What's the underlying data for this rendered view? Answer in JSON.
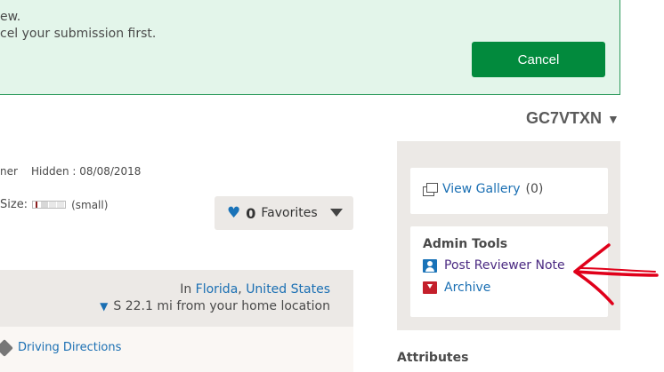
{
  "banner": {
    "line1": "ew.",
    "line2": "cel your submission first.",
    "cancel_label": "Cancel"
  },
  "cache": {
    "code": "GC7VTXN",
    "code_caret": "▼",
    "owner_fragment": "ner",
    "hidden_label": "Hidden : 08/08/2018",
    "size_label": "Size:",
    "size_value": "(small)"
  },
  "favorites": {
    "heart": "♥",
    "count": "0",
    "label": "Favorites"
  },
  "location": {
    "in_prefix": "In",
    "state": "Florida",
    "separator": ", ",
    "country": "United States",
    "distance": "S 22.1 mi from your home location",
    "arrow": "▼"
  },
  "directions": {
    "label": "Driving Directions"
  },
  "sidebar": {
    "gallery_label": "View Gallery",
    "gallery_count": " (0)",
    "admin_title": "Admin Tools",
    "reviewer_note_label": "Post Reviewer Note",
    "archive_label": "Archive"
  },
  "attributes_title": "Attributes",
  "colors": {
    "banner_bg": "#e3f5ea",
    "cancel_button": "#028a3d",
    "link": "#1a6fb3",
    "reviewer_link": "#4b2a82",
    "annotation": "#e0001a"
  }
}
